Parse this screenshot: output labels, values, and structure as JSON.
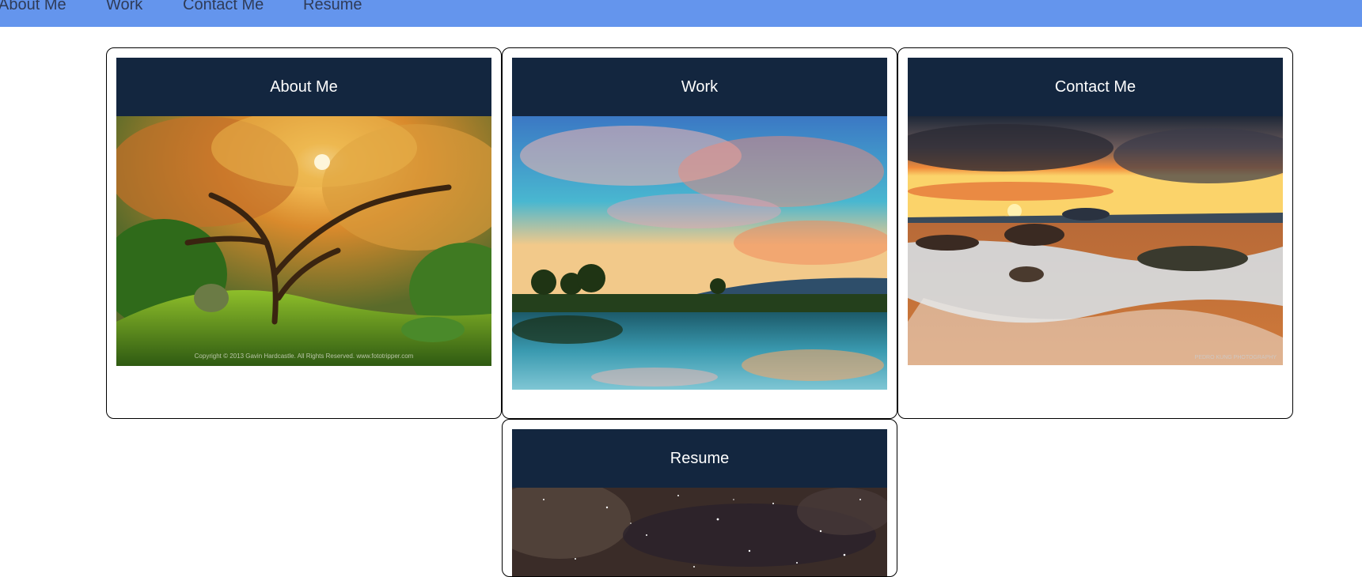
{
  "nav": {
    "items": [
      {
        "label": "About Me"
      },
      {
        "label": "Work"
      },
      {
        "label": "Contact Me"
      },
      {
        "label": "Resume"
      }
    ]
  },
  "cards": [
    {
      "title": "About Me",
      "image": "autumn-japanese-maple-tree-photo",
      "caption": "Copyright © 2013 Gavin Hardcastle. All Rights Reserved. www.fototripper.com"
    },
    {
      "title": "Work",
      "image": "sky-clouds-lake-reflection-photo"
    },
    {
      "title": "Contact Me",
      "image": "sunset-seashore-rocks-photo",
      "caption": "PEDRO KUNG PHOTOGRAPHY"
    },
    {
      "title": "Resume",
      "image": "starry-night-milky-way-photo"
    }
  ],
  "colors": {
    "nav_bg": "#6495ed",
    "nav_text": "#2f3b57",
    "card_header_bg": "#13263f",
    "card_header_text": "#ffffff"
  }
}
